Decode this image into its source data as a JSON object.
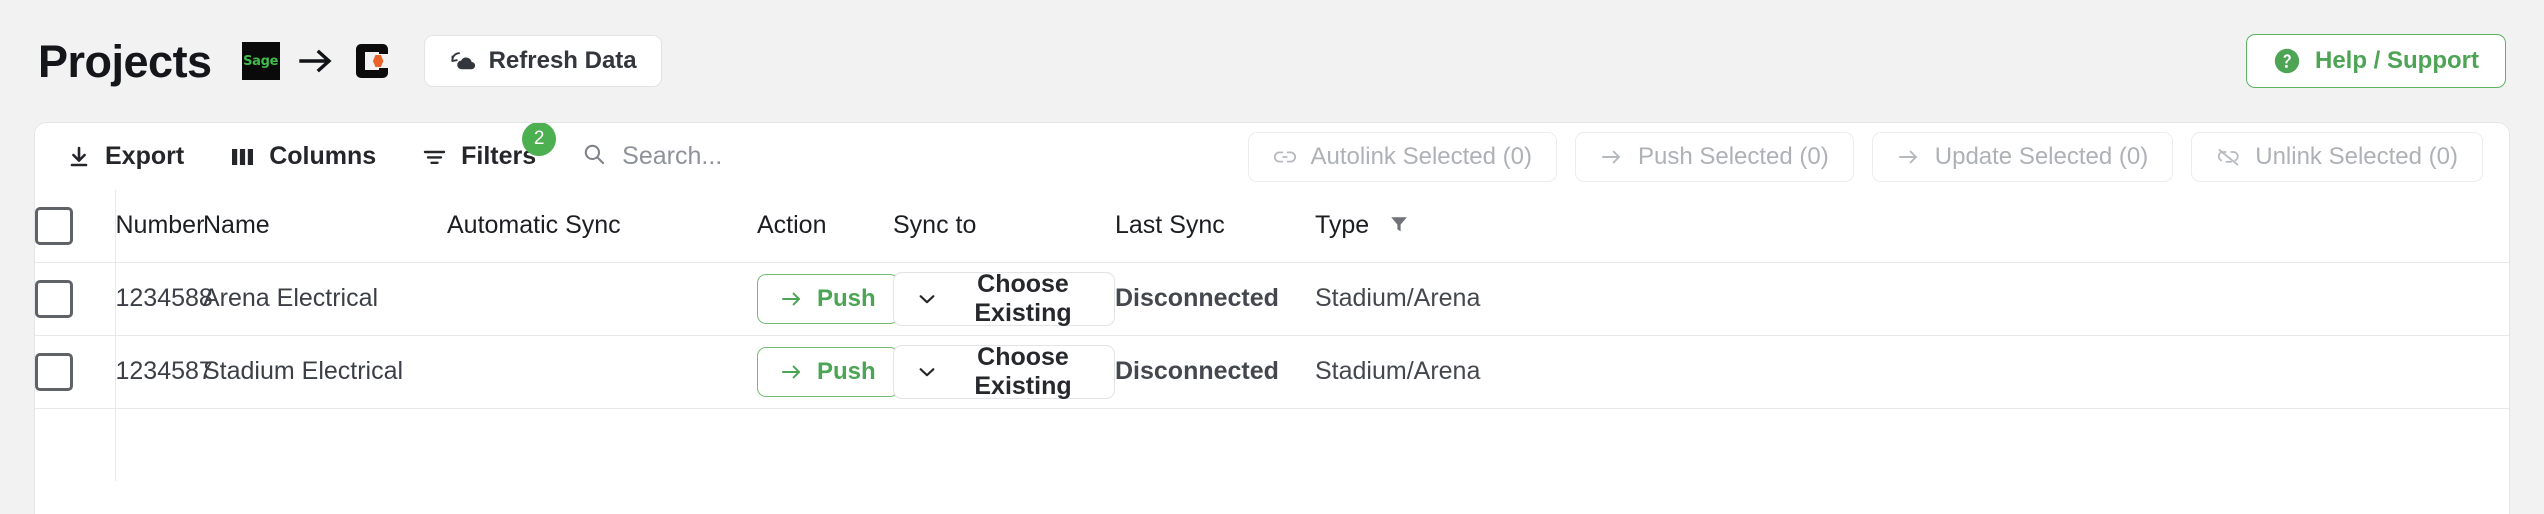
{
  "header": {
    "title": "Projects",
    "source_logo_label": "Sage",
    "transfer_arrow": "arrow-right-icon",
    "target_logo_label": "Procore",
    "refresh_button": "Refresh Data",
    "help_button": "Help / Support"
  },
  "toolbar": {
    "export_label": "Export",
    "columns_label": "Columns",
    "filters_label": "Filters",
    "filters_badge": "2",
    "search_placeholder": "Search...",
    "search_value": "",
    "actions": [
      {
        "label": "Autolink Selected (0)",
        "icon": "link-icon",
        "disabled": true
      },
      {
        "label": "Push Selected (0)",
        "icon": "arrow-right-icon",
        "disabled": true
      },
      {
        "label": "Update Selected (0)",
        "icon": "arrow-right-icon",
        "disabled": true
      },
      {
        "label": "Unlink Selected (0)",
        "icon": "unlink-icon",
        "disabled": true
      }
    ]
  },
  "table": {
    "columns": [
      {
        "key": "number",
        "label": "Number"
      },
      {
        "key": "name",
        "label": "Name"
      },
      {
        "key": "automatic_sync",
        "label": "Automatic Sync"
      },
      {
        "key": "action",
        "label": "Action"
      },
      {
        "key": "sync_to",
        "label": "Sync to"
      },
      {
        "key": "last_sync",
        "label": "Last Sync"
      },
      {
        "key": "type",
        "label": "Type",
        "filtered": true
      }
    ],
    "rows": [
      {
        "number": "1234588",
        "name": "Arena Electrical",
        "automatic_sync": "",
        "action_label": "Push",
        "sync_to_label": "Choose Existing",
        "last_sync": "Disconnected",
        "type": "Stadium/Arena"
      },
      {
        "number": "1234587",
        "name": "Stadium Electrical",
        "automatic_sync": "",
        "action_label": "Push",
        "sync_to_label": "Choose Existing",
        "last_sync": "Disconnected",
        "type": "Stadium/Arena"
      }
    ]
  },
  "colors": {
    "accent_green": "#4caf50",
    "push_green": "#4ca554",
    "sage_green": "#3fbb4c",
    "procore_orange": "#e8622a",
    "page_bg": "#f2f2f3"
  }
}
